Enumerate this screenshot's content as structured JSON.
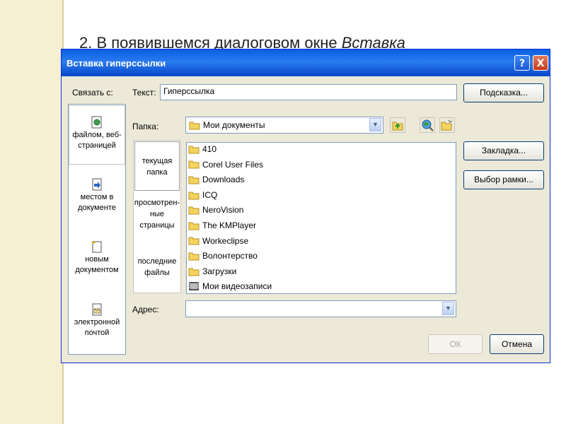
{
  "slide": {
    "caption_prefix": "2. В появившемся диалоговом окне ",
    "caption_italic": "Вставка"
  },
  "dialog": {
    "title": "Вставка гиперссылки",
    "help_label": "?",
    "close_label": "X",
    "link_to_label": "Связать с:",
    "text_label": "Текст:",
    "text_value": "Гиперссылка",
    "tooltip_button": "Подсказка...",
    "folder_label": "Папка:",
    "folder_value": "Мои документы",
    "bookmark_button": "Закладка...",
    "frame_button": "Выбор рамки...",
    "address_label": "Адрес:",
    "address_value": "",
    "ok_button": "ОК",
    "cancel_button": "Отмена",
    "link_options": [
      {
        "label": "файлом, веб-страницей",
        "icon": "web-file-icon",
        "selected": true
      },
      {
        "label": "местом в документе",
        "icon": "document-place-icon",
        "selected": false
      },
      {
        "label": "новым документом",
        "icon": "new-document-icon",
        "selected": false
      },
      {
        "label": "электронной почтой",
        "icon": "email-icon",
        "selected": false
      }
    ],
    "places": [
      {
        "label": "текущая папка",
        "selected": true
      },
      {
        "label": "просмотрен-ные страницы",
        "selected": false
      },
      {
        "label": "последние файлы",
        "selected": false
      }
    ],
    "files": [
      {
        "name": "410",
        "icon": "folder-icon"
      },
      {
        "name": "Corel User Files",
        "icon": "folder-icon"
      },
      {
        "name": "Downloads",
        "icon": "folder-icon"
      },
      {
        "name": "ICQ",
        "icon": "folder-icon"
      },
      {
        "name": "NeroVision",
        "icon": "folder-icon"
      },
      {
        "name": "The KMPlayer",
        "icon": "folder-icon"
      },
      {
        "name": "Workeclipse",
        "icon": "folder-icon"
      },
      {
        "name": "Волонтерство",
        "icon": "folder-icon"
      },
      {
        "name": "Загрузки",
        "icon": "folder-icon"
      },
      {
        "name": "Мои видеозаписи",
        "icon": "video-folder-icon"
      }
    ]
  }
}
